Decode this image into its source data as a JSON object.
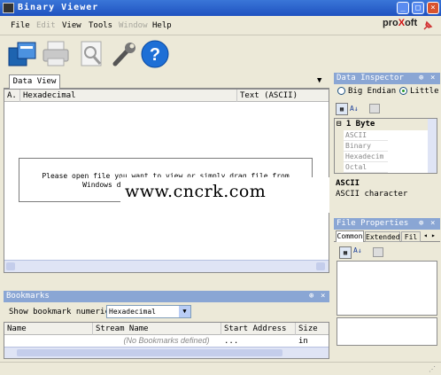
{
  "window": {
    "title": "Binary  Viewer"
  },
  "menu": {
    "file": "File",
    "edit": "Edit",
    "view": "View",
    "tools": "Tools",
    "window": "Window",
    "help": "Help"
  },
  "brand": {
    "left": "pro",
    "mid": "X",
    "right": "oft"
  },
  "toolbar": {
    "icons": [
      "open-file-icon",
      "print-icon",
      "preview-icon",
      "wrench-icon",
      "help-icon"
    ]
  },
  "data_view": {
    "tab": "Data View",
    "columns": [
      "A.",
      "Hexadecimal",
      "Text (ASCII)"
    ],
    "message_line1": "Please open file you want to view or simply drag file from",
    "message_line2": "Windows dire"
  },
  "watermark": "www.cncrk.com",
  "inspector": {
    "title": "Data Inspector",
    "big_endian": "Big Endian",
    "little_endian": "Little E",
    "group": "1 Byte",
    "rows": [
      "ASCII",
      "Binary",
      "Hexadecim",
      "Octal"
    ],
    "desc_title": "ASCII",
    "desc_text": "ASCII character"
  },
  "file_properties": {
    "title": "File Properties",
    "tabs": [
      "Common",
      "Extended",
      "Fil"
    ]
  },
  "bookmarks": {
    "title": "Bookmarks",
    "show_label": "Show bookmark numerics as",
    "numerics_value": "Hexadecimal",
    "columns": [
      "Name",
      "Stream Name",
      "Start Address ...",
      "Size in"
    ],
    "empty": "(No Bookmarks defined)"
  },
  "colors": {
    "titlebar": "#2a62d0",
    "panel_header": "#8aa6d4",
    "face": "#ece9d8"
  }
}
